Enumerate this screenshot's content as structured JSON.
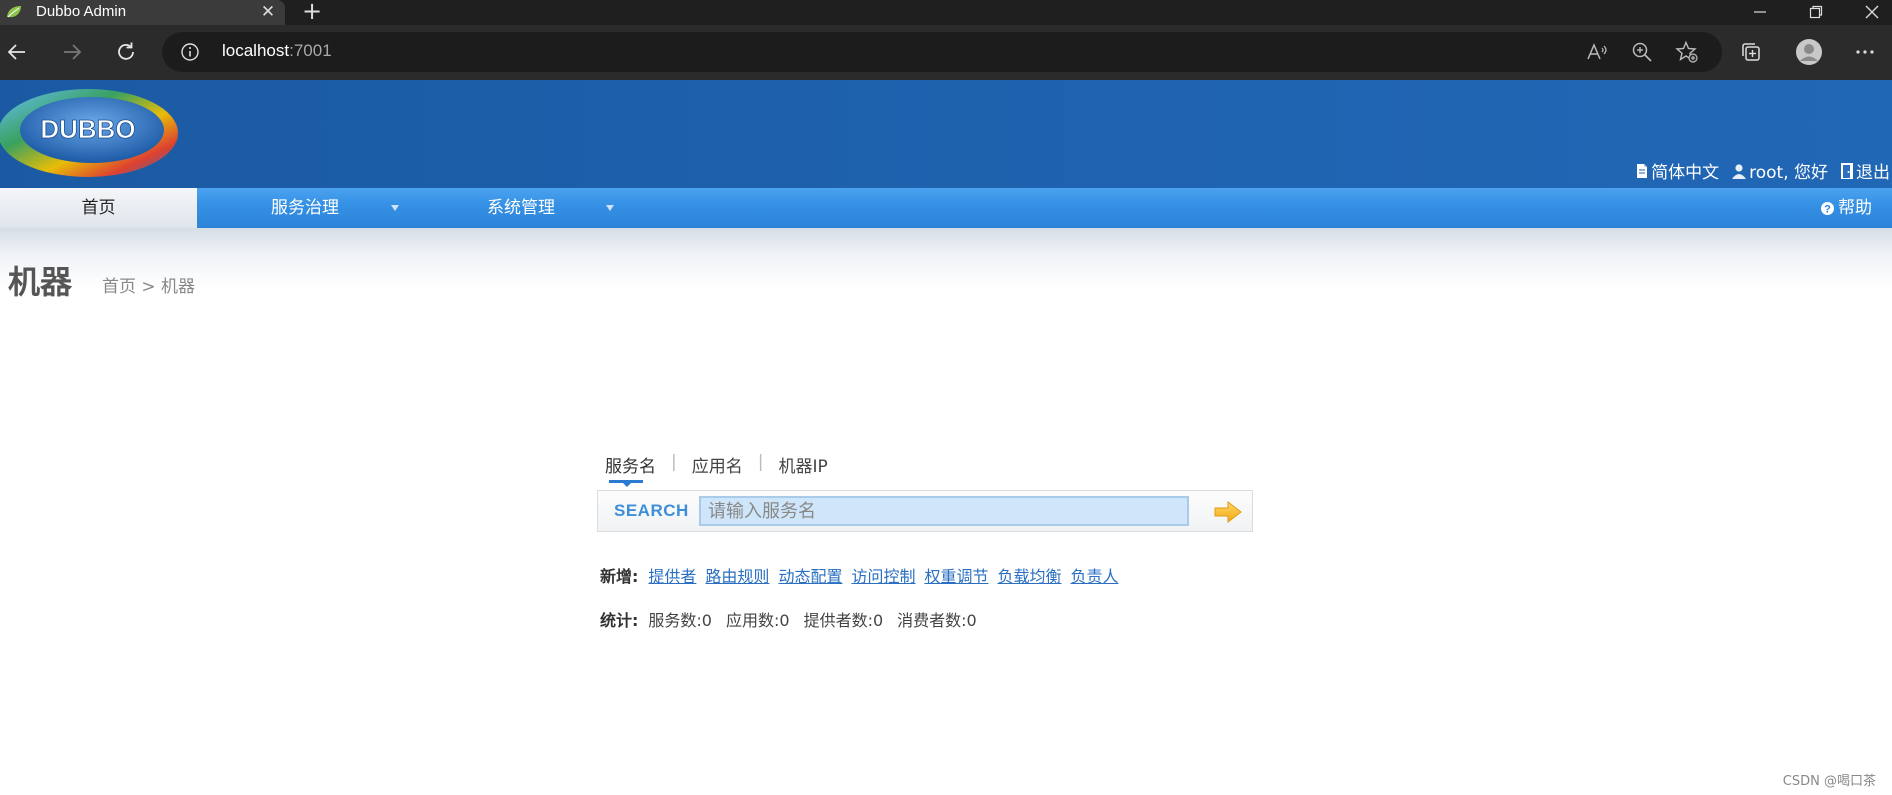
{
  "browser": {
    "tab_title": "Dubbo Admin",
    "url_host": "localhost",
    "url_port": ":7001"
  },
  "header": {
    "logo_text": "DUBBO",
    "language": "简体中文",
    "user_greeting": "root, 您好",
    "logout": "退出"
  },
  "nav": {
    "items": [
      {
        "label": "首页"
      },
      {
        "label": "服务治理"
      },
      {
        "label": "系统管理"
      }
    ],
    "help": "帮助"
  },
  "page": {
    "title": "机器",
    "breadcrumb": "首页 > 机器"
  },
  "search": {
    "tabs": [
      "服务名",
      "应用名",
      "机器IP"
    ],
    "label": "SEARCH",
    "placeholder": "请输入服务名"
  },
  "add": {
    "label": "新增:",
    "links": [
      "提供者",
      "路由规则",
      "动态配置",
      "访问控制",
      "权重调节",
      "负载均衡",
      "负责人"
    ]
  },
  "stats": {
    "label": "统计:",
    "items": [
      "服务数:0",
      "应用数:0",
      "提供者数:0",
      "消费者数:0"
    ]
  },
  "watermark": "CSDN @喝口茶",
  "colors": {
    "header_blue": "#1f63b0",
    "nav_blue": "#3490e4",
    "link_blue": "#2a6fc2"
  }
}
